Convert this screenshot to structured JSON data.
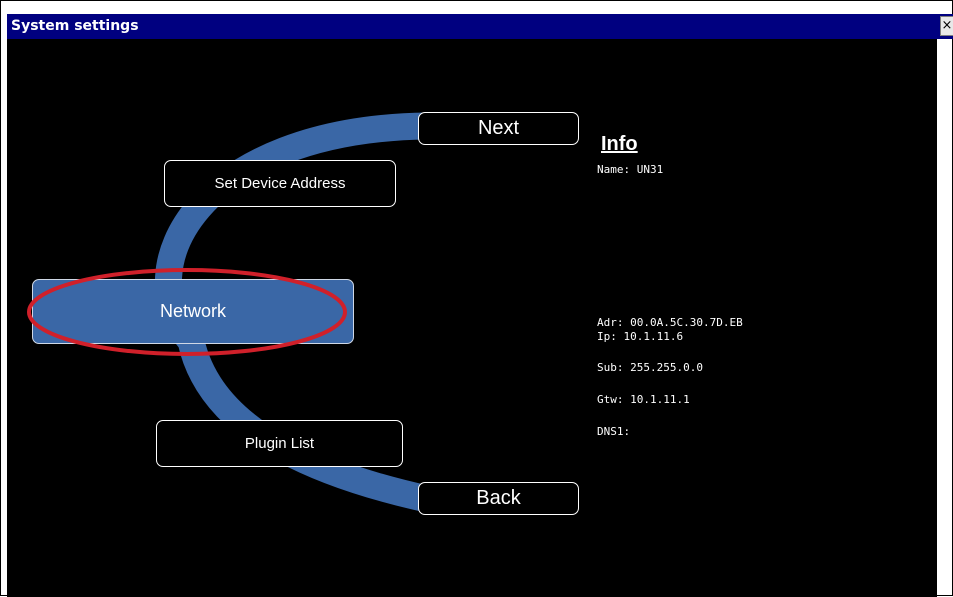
{
  "window": {
    "title": "System settings",
    "close_label": "×"
  },
  "menu": {
    "next_label": "Next",
    "set_device_address_label": "Set Device Address",
    "network_label": "Network",
    "plugin_list_label": "Plugin List",
    "back_label": "Back",
    "selected": "Network"
  },
  "info": {
    "heading": "Info",
    "name": "Name: UN31",
    "adr": "Adr: 00.0A.5C.30.7D.EB",
    "ip": "Ip: 10.1.11.6",
    "sub": "Sub: 255.255.0.0",
    "gtw": "Gtw: 10.1.11.1",
    "dns1": "DNS1:"
  },
  "colors": {
    "titlebar": "#000080",
    "background": "#000000",
    "arc": "#3a67a6",
    "selected_button": "#3a67a6",
    "highlight_ring": "#d0202a",
    "text": "#ffffff"
  }
}
